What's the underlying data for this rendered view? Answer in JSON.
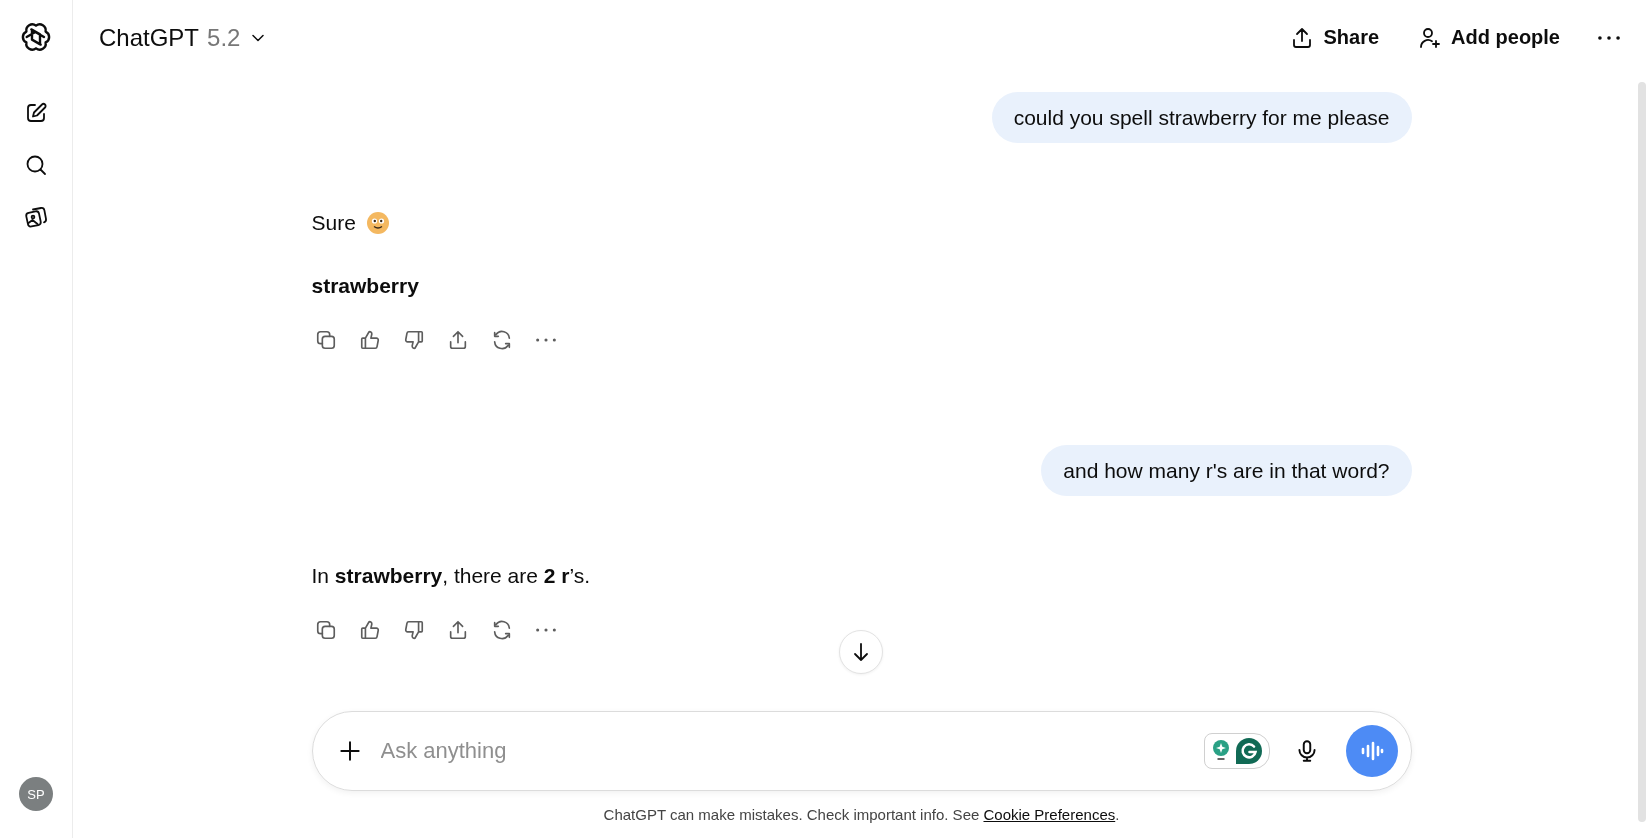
{
  "header": {
    "model_name": "ChatGPT",
    "model_version": "5.2",
    "share": "Share",
    "add_people": "Add people"
  },
  "messages": [
    {
      "kind": "user",
      "text": "could you spell strawberry for me please"
    },
    {
      "kind": "assistant",
      "paragraphs": [
        {
          "text": "Sure",
          "bold": false,
          "emoji": true
        },
        {
          "text": "strawberry",
          "bold": true,
          "emoji": false
        }
      ]
    },
    {
      "kind": "user",
      "text": "and how many r's are in that word?"
    },
    {
      "kind": "assistant",
      "paragraphs": [
        {
          "text": "In **strawberry**, there are **2 r**’s.",
          "bold": false,
          "emoji": false
        }
      ]
    }
  ],
  "composer": {
    "placeholder": "Ask anything"
  },
  "footer": {
    "text": "ChatGPT can make mistakes. Check important info. See",
    "link": "Cookie Preferences",
    "end": "."
  },
  "user": {
    "initials": "SP"
  }
}
